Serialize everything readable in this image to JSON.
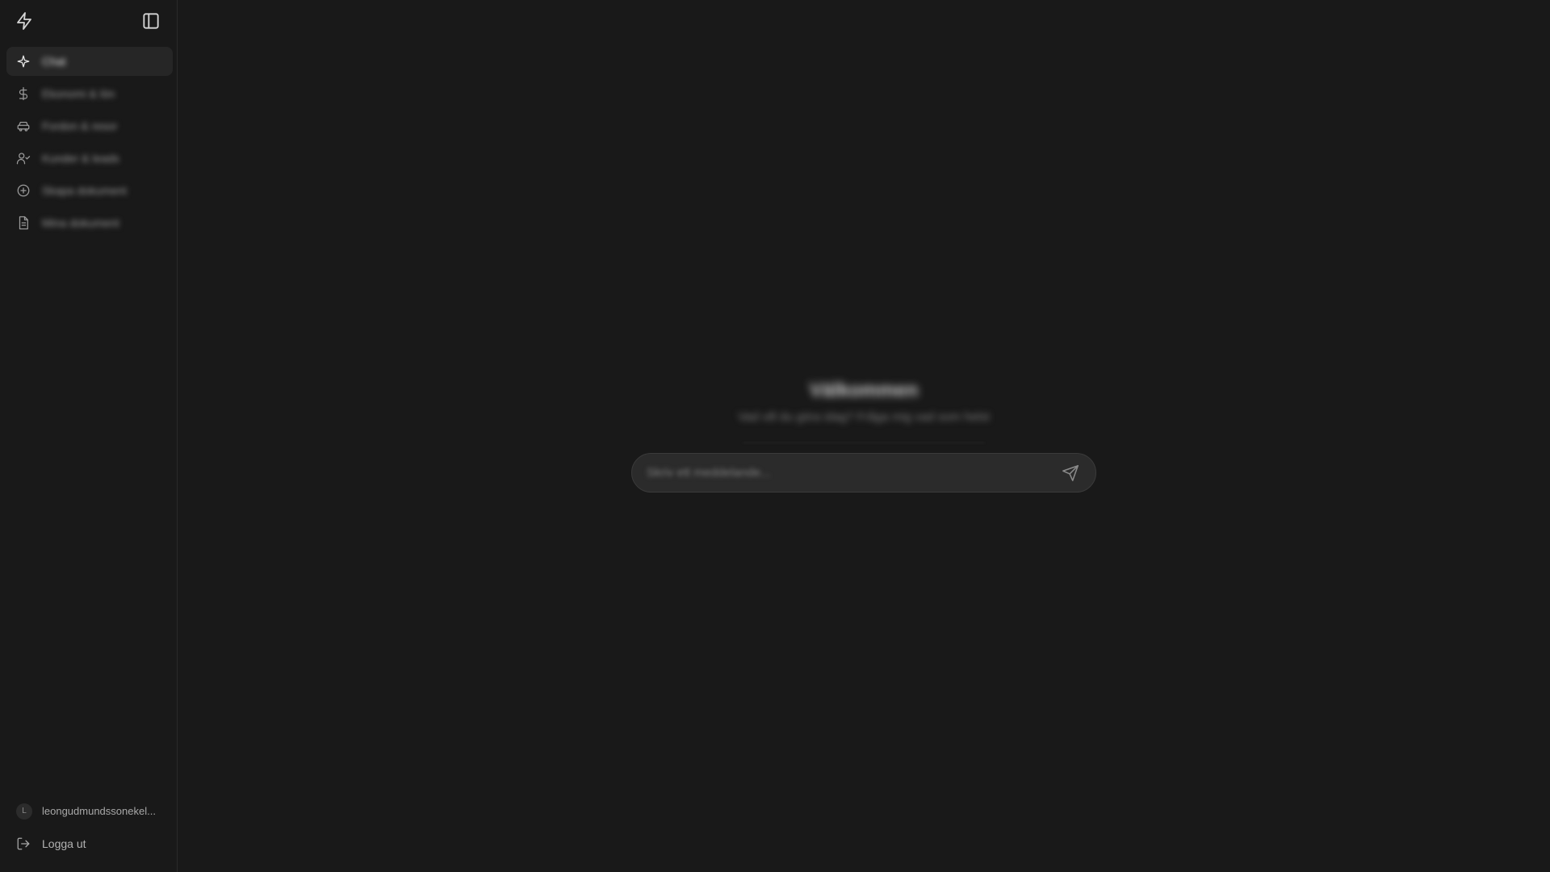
{
  "sidebar": {
    "items": [
      {
        "label": "Chat",
        "icon": "sparkle-icon",
        "active": true
      },
      {
        "label": "Ekonomi & lön",
        "icon": "dollar-icon",
        "active": false
      },
      {
        "label": "Fordon & resor",
        "icon": "car-icon",
        "active": false
      },
      {
        "label": "Kunder & leads",
        "icon": "user-check-icon",
        "active": false
      },
      {
        "label": "Skapa dokument",
        "icon": "plus-circle-icon",
        "active": false
      },
      {
        "label": "Mina dokument",
        "icon": "file-icon",
        "active": false
      }
    ],
    "user": {
      "initial": "L",
      "email": "leongudmundssonekel..."
    },
    "logout_label": "Logga ut"
  },
  "main": {
    "title": "Välkommen",
    "subtitle": "Vad vill du göra idag? Fråga mig vad som helst",
    "input_placeholder": "Skriv ett meddelande..."
  },
  "colors": {
    "background": "#191919",
    "input_bg": "#2b2b2b",
    "active_nav_bg": "#262626"
  }
}
